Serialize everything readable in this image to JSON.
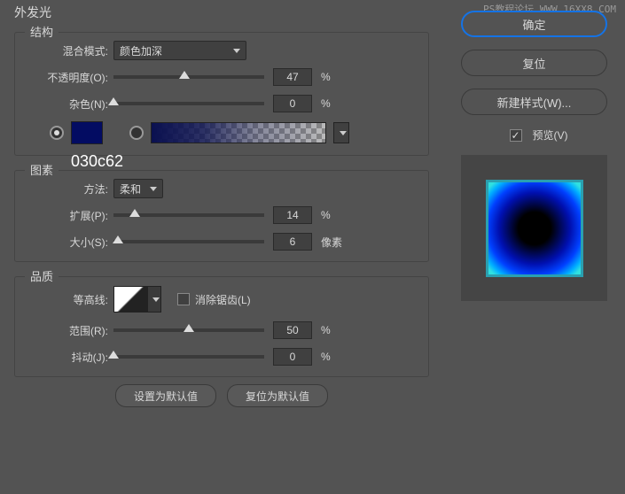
{
  "watermark": "PS教程论坛 WWW.16XX8.COM",
  "panelTitle": "外发光",
  "colorAnnotation": "030c62",
  "structure": {
    "title": "结构",
    "blendModeLabel": "混合模式:",
    "blendModeValue": "颜色加深",
    "opacityLabel": "不透明度(O):",
    "opacityValue": "47",
    "opacityUnit": "%",
    "noiseLabel": "杂色(N):",
    "noiseValue": "0",
    "noiseUnit": "%"
  },
  "elements": {
    "title": "图素",
    "methodLabel": "方法:",
    "methodValue": "柔和",
    "spreadLabel": "扩展(P):",
    "spreadValue": "14",
    "spreadUnit": "%",
    "sizeLabel": "大小(S):",
    "sizeValue": "6",
    "sizeUnit": "像素"
  },
  "quality": {
    "title": "品质",
    "contourLabel": "等高线:",
    "antiAliasLabel": "消除锯齿(L)",
    "rangeLabel": "范围(R):",
    "rangeValue": "50",
    "rangeUnit": "%",
    "jitterLabel": "抖动(J):",
    "jitterValue": "0",
    "jitterUnit": "%"
  },
  "buttons": {
    "setDefault": "设置为默认值",
    "resetDefault": "复位为默认值"
  },
  "side": {
    "ok": "确定",
    "reset": "复位",
    "newStyle": "新建样式(W)...",
    "preview": "预览(V)"
  }
}
